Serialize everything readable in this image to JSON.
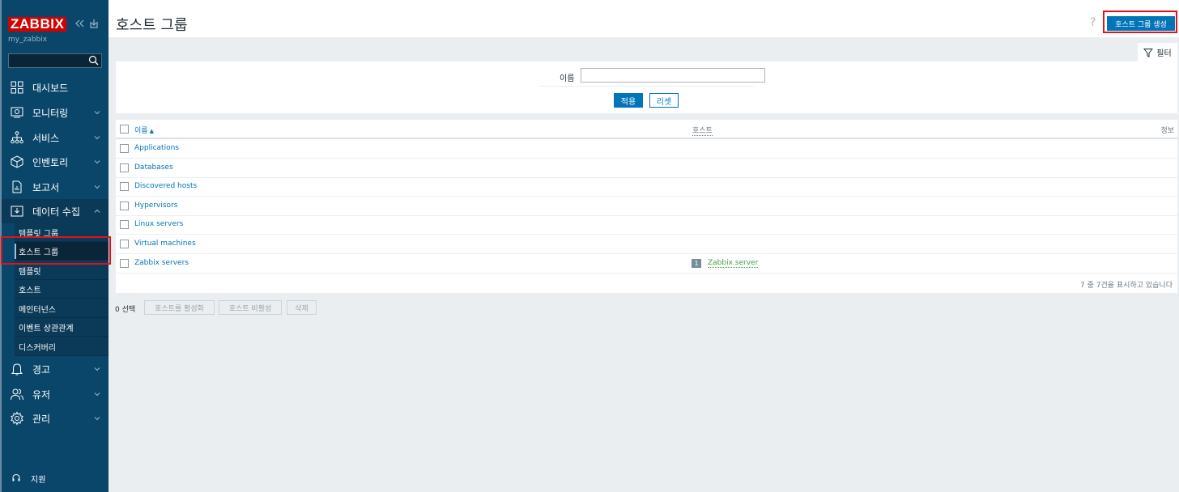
{
  "sidebar": {
    "logo": "ZABBIX",
    "server_name": "my_zabbix",
    "search_placeholder": "",
    "items": [
      {
        "label": "대시보드"
      },
      {
        "label": "모니터링"
      },
      {
        "label": "서비스"
      },
      {
        "label": "인벤토리"
      },
      {
        "label": "보고서"
      },
      {
        "label": "데이터 수집"
      },
      {
        "label": "경고"
      },
      {
        "label": "유저"
      },
      {
        "label": "관리"
      }
    ],
    "subitems": [
      {
        "label": "템플릿 그룹"
      },
      {
        "label": "호스트 그룹"
      },
      {
        "label": "템플릿"
      },
      {
        "label": "호스트"
      },
      {
        "label": "메인터넌스"
      },
      {
        "label": "이벤트 상관관계"
      },
      {
        "label": "디스커버리"
      }
    ],
    "support_label": "지원"
  },
  "header": {
    "title": "호스트 그룹",
    "help": "?",
    "create_button": "호스트 그룹 생성"
  },
  "filter": {
    "tab_label": "필터",
    "name_label": "이름",
    "name_value": "",
    "apply_label": "적용",
    "reset_label": "리셋"
  },
  "table": {
    "headers": {
      "name": "이름",
      "sort": "▲",
      "hosts": "호스트",
      "info": "정보"
    },
    "rows": [
      {
        "name": "Applications"
      },
      {
        "name": "Databases"
      },
      {
        "name": "Discovered hosts"
      },
      {
        "name": "Hypervisors"
      },
      {
        "name": "Linux servers"
      },
      {
        "name": "Virtual machines"
      },
      {
        "name": "Zabbix servers",
        "host_count": "1",
        "host": "Zabbix server"
      }
    ],
    "footer": "7 중 7건을 표시하고 있습니다"
  },
  "actions": {
    "selected": "0 선택",
    "enable": "호스트를 활성화",
    "disable": "호스트 비활성",
    "delete": "삭제"
  },
  "colors": {
    "sidebar_bg": "#0a466a",
    "accent": "#0275b8",
    "logo_red": "#d40000",
    "highlight_red": "#e0121b",
    "host_green": "#429e47"
  }
}
